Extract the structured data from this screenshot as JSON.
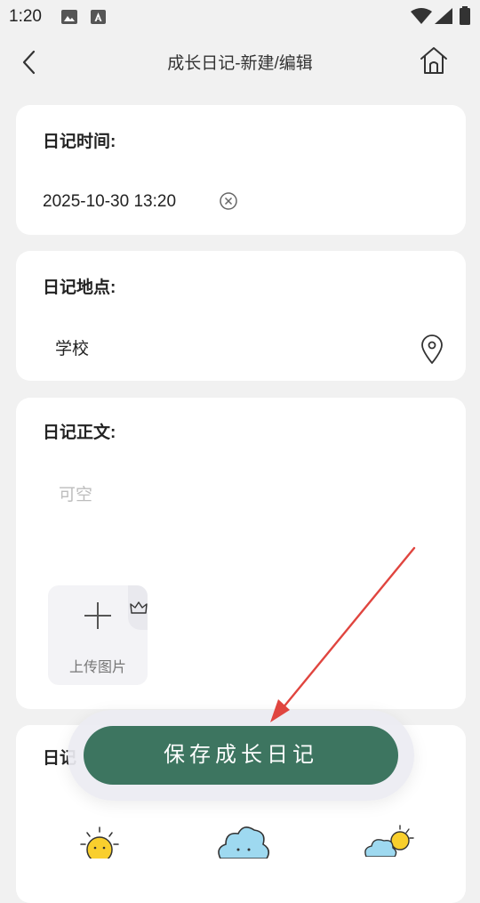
{
  "status_bar": {
    "time": "1:20"
  },
  "header": {
    "title": "成长日记-新建/编辑"
  },
  "time_card": {
    "label": "日记时间:",
    "value": "2025-10-30 13:20"
  },
  "location_card": {
    "label": "日记地点:",
    "value": "学校"
  },
  "body_card": {
    "label": "日记正文:",
    "placeholder": "可空",
    "upload_label": "上传图片"
  },
  "weather_card": {
    "label": "日记"
  },
  "save_button": {
    "label": "保存成长日记"
  },
  "colors": {
    "accent": "#3d7560",
    "background": "#f1f1f1",
    "annotation_arrow": "#e0453f"
  }
}
